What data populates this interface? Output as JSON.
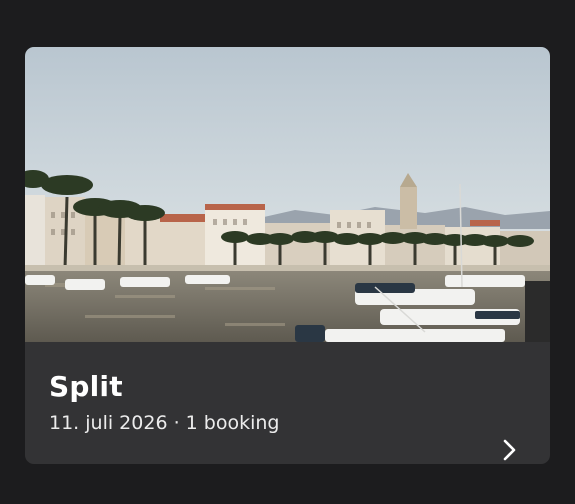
{
  "trip_card": {
    "destination": "Split",
    "date": "11. juli 2026",
    "separator": " · ",
    "booking_count": "1 booking",
    "photo_icon": "harbor-photo",
    "chevron_icon": "chevron-right-icon"
  },
  "colors": {
    "background": "#1c1c1e",
    "card": "#333335",
    "title": "#ffffff",
    "subtitle": "#ececec"
  }
}
